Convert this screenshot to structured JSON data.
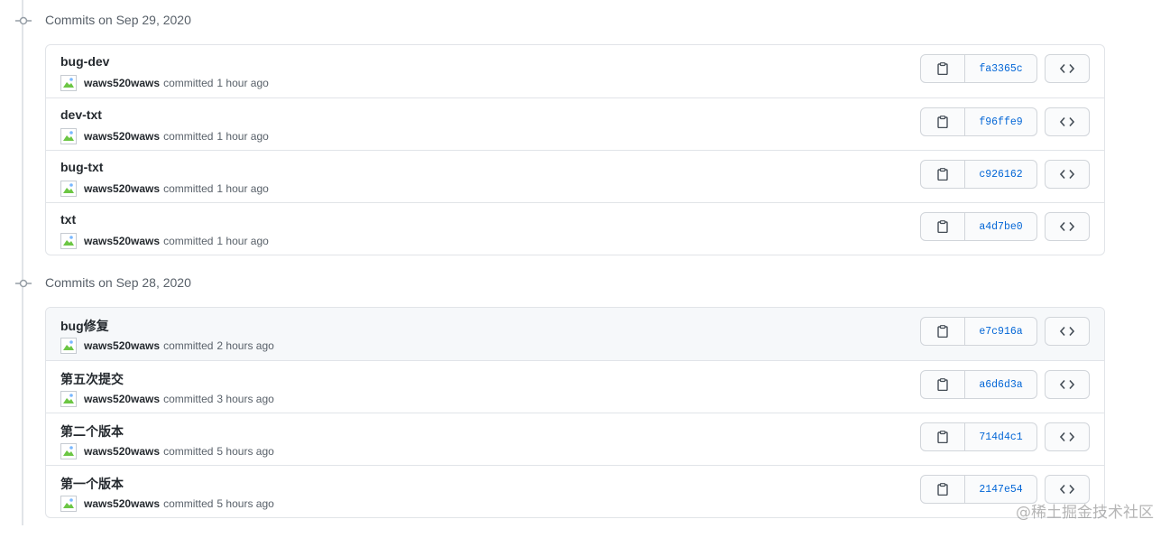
{
  "groups": [
    {
      "title": "Commits on Sep 29, 2020",
      "commits": [
        {
          "message": "bug-dev",
          "author": "waws520waws",
          "verb": "committed",
          "time": "1 hour ago",
          "sha": "fa3365c"
        },
        {
          "message": "dev-txt",
          "author": "waws520waws",
          "verb": "committed",
          "time": "1 hour ago",
          "sha": "f96ffe9"
        },
        {
          "message": "bug-txt",
          "author": "waws520waws",
          "verb": "committed",
          "time": "1 hour ago",
          "sha": "c926162"
        },
        {
          "message": "txt",
          "author": "waws520waws",
          "verb": "committed",
          "time": "1 hour ago",
          "sha": "a4d7be0"
        }
      ]
    },
    {
      "title": "Commits on Sep 28, 2020",
      "commits": [
        {
          "message": "bug修复",
          "author": "waws520waws",
          "verb": "committed",
          "time": "2 hours ago",
          "sha": "e7c916a"
        },
        {
          "message": "第五次提交",
          "author": "waws520waws",
          "verb": "committed",
          "time": "3 hours ago",
          "sha": "a6d6d3a"
        },
        {
          "message": "第二个版本",
          "author": "waws520waws",
          "verb": "committed",
          "time": "5 hours ago",
          "sha": "714d4c1"
        },
        {
          "message": "第一个版本",
          "author": "waws520waws",
          "verb": "committed",
          "time": "5 hours ago",
          "sha": "2147e54"
        }
      ]
    }
  ],
  "icons": {
    "commit_node": "git-commit-icon",
    "copy": "clipboard-icon",
    "browse": "code-icon",
    "avatar": "broken-avatar-image"
  },
  "colors": {
    "link": "#0366d6",
    "border": "#e1e4e8",
    "muted": "#586069",
    "hover_row": "#f6f8fa"
  },
  "watermark": "@稀土掘金技术社区"
}
